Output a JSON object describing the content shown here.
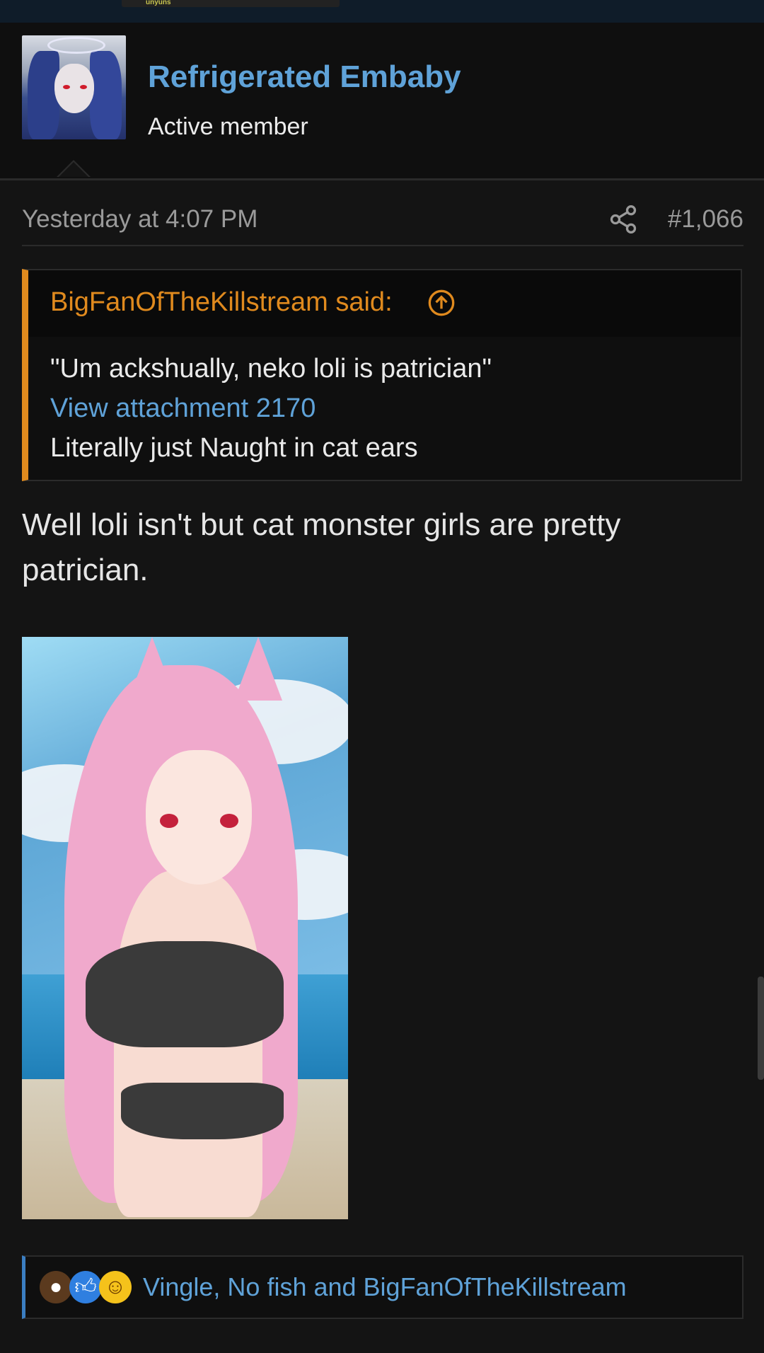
{
  "topbar": {
    "snippet_text": "unyuns"
  },
  "post": {
    "author": {
      "name": "Refrigerated Embaby",
      "title": "Active member"
    },
    "timestamp": "Yesterday at 4:07 PM",
    "post_number": "#1,066",
    "quote": {
      "attribution": "BigFanOfTheKillstream said:",
      "lines": [
        "\"Um ackshually, neko loli is patrician\"",
        "View attachment 2170",
        "Literally just Naught in cat ears"
      ]
    },
    "body": "Well loli isn't but cat monster girls are pretty patrician.",
    "reactions": {
      "icons": [
        "poop-icon",
        "like-icon",
        "laugh-icon"
      ],
      "users_text": "Vingle, No fish and BigFanOfTheKillstream"
    }
  },
  "colors": {
    "background": "#141414",
    "username": "#5fa2d8",
    "quote_accent": "#e08a1e",
    "link": "#5fa2d8"
  }
}
